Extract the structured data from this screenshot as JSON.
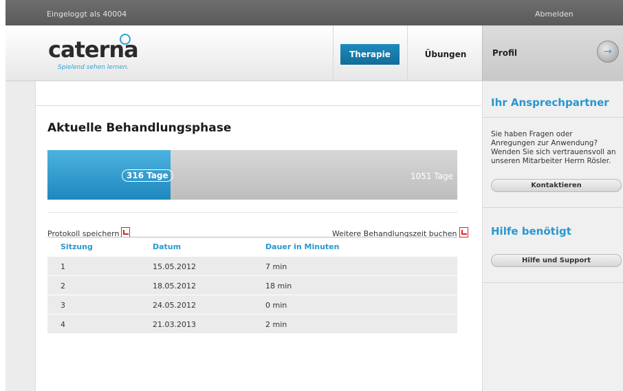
{
  "topbar": {
    "user_text": "Eingeloggt als 40004",
    "logout_label": "Abmelden"
  },
  "logo": {
    "word": "caterna",
    "tagline": "Spielend sehen lernen."
  },
  "nav": {
    "therapie": "Therapie",
    "uebungen": "Übungen",
    "profil": "Profil",
    "profil_arrow": "→"
  },
  "colors": {
    "accent": "#2897cf",
    "active_tab": "#1f8bbd",
    "progress_fill": "#4cb3e0"
  },
  "main": {
    "title": "Aktuelle Behandlungsphase",
    "progress": {
      "done_label": "316 Tage",
      "total_label": "1051 Tage",
      "done_days": 316,
      "total_days": 1051,
      "fraction": 0.3
    },
    "link_protokoll": "Protokoll speichern",
    "link_weitere": "Weitere Behandlungszeit buchen",
    "table": {
      "headers": [
        "Sitzung",
        "Datum",
        "Dauer in Minuten"
      ],
      "rows": [
        [
          "1",
          "15.05.2012",
          "7 min"
        ],
        [
          "2",
          "18.05.2012",
          "18 min"
        ],
        [
          "3",
          "24.05.2012",
          "0 min"
        ],
        [
          "4",
          "21.03.2013",
          "2 min"
        ]
      ]
    }
  },
  "sidebar": {
    "contact_title": "Ihr Ansprechpartner",
    "contact_text": "Sie haben Fragen oder Anregungen zur Anwendung? Wenden Sie sich vertrauensvoll an unseren Mitarbeiter Herrn Rösler.",
    "contact_button": "Kontaktieren",
    "help_title": "Hilfe benötigt",
    "help_button": "Hilfe und Support"
  },
  "icons": {
    "pdf": "pdf-icon",
    "arrow": "arrow-right-icon"
  }
}
